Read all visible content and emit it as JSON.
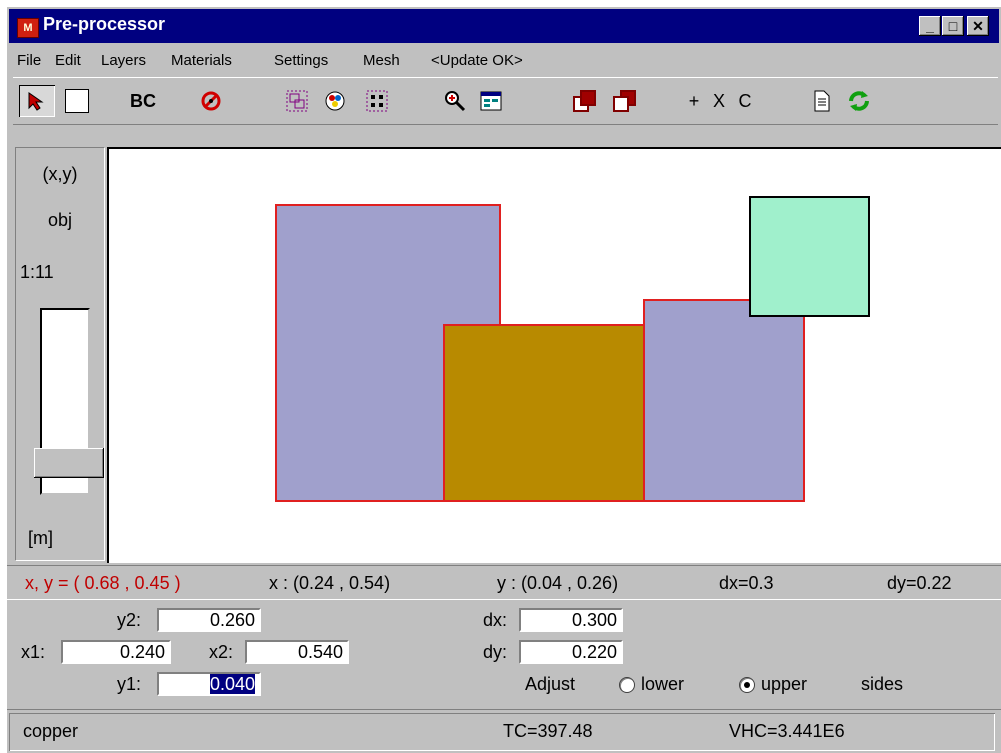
{
  "window": {
    "title": "Pre-processor",
    "icon_text": "M",
    "controls": {
      "minimize": "_",
      "maximize": "□",
      "close": "✕"
    }
  },
  "menu": [
    "File",
    "Edit",
    "Layers",
    "Materials",
    "Settings",
    "Mesh",
    "<Update OK>"
  ],
  "toolbar": {
    "bc_label": "BC",
    "plus_label": "+",
    "x_label": "X",
    "c_label": "C",
    "icons": [
      "pointer-icon",
      "rectangle-icon",
      "bc-text",
      "no-entry-icon",
      "select-region-icon",
      "palette-icon",
      "grid-dots-icon",
      "zoom-icon",
      "window-icon",
      "layer-front-icon",
      "layer-back-icon",
      "document-icon",
      "refresh-icon"
    ]
  },
  "left_panel": {
    "xy_label": "(x,y)",
    "obj_label": "obj",
    "scale_label": "1:11",
    "unit_label": "[m]",
    "slider_fraction": 0.83
  },
  "coords": {
    "cursor": "x, y = ( 0.68 ,  0.45 )",
    "x_range": "x :  (0.24 ,  0.54)",
    "y_range": "y :  (0.04 ,  0.26)",
    "dx": "dx=0.3",
    "dy": "dy=0.22"
  },
  "edit": {
    "y2_label": "y2:",
    "y2_value": "0.260",
    "x1_label": "x1:",
    "x1_value": "0.240",
    "x2_label": "x2:",
    "x2_value": "0.540",
    "y1_label": "y1:",
    "y1_value": "0.040",
    "dx_label": "dx:",
    "dx_value": "0.300",
    "dy_label": "dy:",
    "dy_value": "0.220",
    "adjust_label": "Adjust",
    "lower_label": "lower",
    "upper_label": "upper",
    "sides_label": "sides",
    "selected_adjust": "upper"
  },
  "status": {
    "material": "copper",
    "tc": "TC=397.48",
    "vhc": "VHC=3.441E6"
  },
  "colors": {
    "title_bg": "#000080",
    "lavender_fill": "#a0a0cc",
    "copper_fill": "#b88a00",
    "mint_fill": "#a0f0cc",
    "outline_red": "#e02020",
    "coord_red": "#c00000"
  }
}
